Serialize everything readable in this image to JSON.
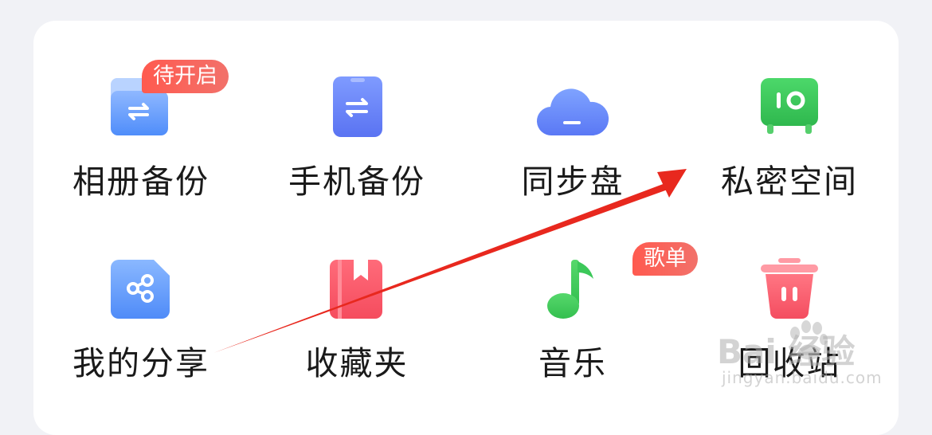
{
  "features": [
    {
      "id": "album-backup",
      "label": "相册备份",
      "badge": "待开启",
      "icon": "album-backup-icon"
    },
    {
      "id": "phone-backup",
      "label": "手机备份",
      "icon": "phone-backup-icon"
    },
    {
      "id": "sync-disk",
      "label": "同步盘",
      "icon": "cloud-sync-icon"
    },
    {
      "id": "private-space",
      "label": "私密空间",
      "icon": "safe-icon"
    },
    {
      "id": "my-share",
      "label": "我的分享",
      "icon": "share-icon"
    },
    {
      "id": "favorites",
      "label": "收藏夹",
      "icon": "bookmark-icon"
    },
    {
      "id": "music",
      "label": "音乐",
      "badge": "歌单",
      "icon": "music-note-icon"
    },
    {
      "id": "recycle-bin",
      "label": "回收站",
      "icon": "trash-icon"
    }
  ],
  "watermark": {
    "brand": "Bai 经验",
    "url": "jingyan.baidu.com"
  },
  "colors": {
    "badge": "#ff5a4f",
    "arrow": "#e8281e",
    "blue": "#5b8cff",
    "green": "#3cc85a",
    "red": "#ff5c6c"
  }
}
